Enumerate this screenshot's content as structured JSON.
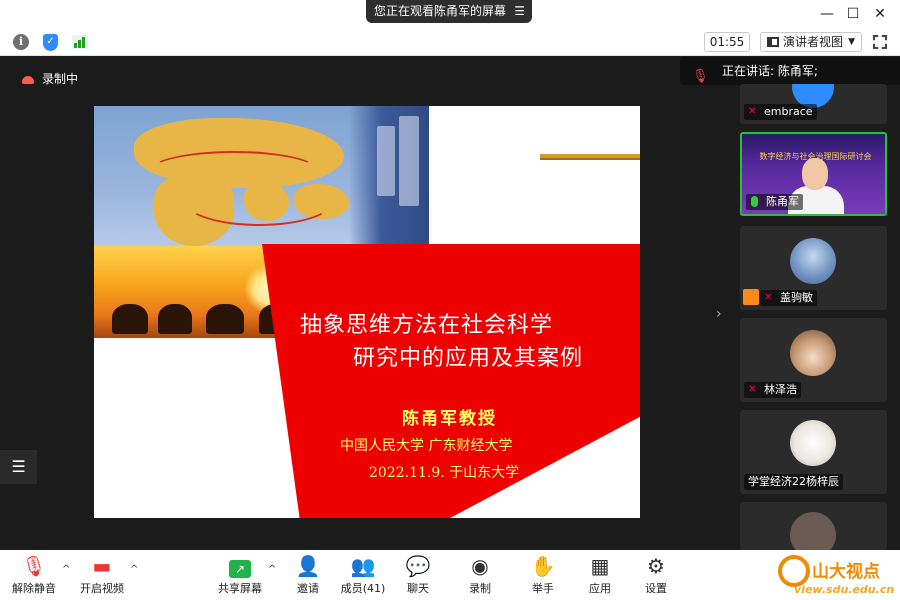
{
  "titlebar": {
    "share_status": "您正在观看陈甬军的屏幕",
    "minimize": "—",
    "maximize": "☐",
    "close": "✕"
  },
  "toolbar": {
    "timer": "01:55",
    "view_mode": "演讲者视图"
  },
  "recording": {
    "label": "录制中"
  },
  "speaker": {
    "label": "正在讲话: 陈甬军;"
  },
  "slide": {
    "title_line1": "抽象思维方法在社会科学",
    "title_line2": "研究中的应用及其案例",
    "author": "陈甬军教授",
    "affiliation": "中国人民大学  广东财经大学",
    "date": "2022.11.9. 于山东大学"
  },
  "participants": [
    {
      "name": "embrace"
    },
    {
      "name": "陈甬军",
      "banner": "数字经济与社会治理国际研讨会"
    },
    {
      "name": "盖驹敏"
    },
    {
      "name": "林泽浩"
    },
    {
      "name": "学堂经济22杨梓辰"
    }
  ],
  "bottom_toolbar": {
    "unmute": "解除静音",
    "start_video": "开启视频",
    "share_screen": "共享屏幕",
    "invite": "邀请",
    "participants": "成员(41)",
    "chat": "聊天",
    "record": "录制",
    "raise_hand": "举手",
    "apps": "应用",
    "settings": "设置"
  },
  "watermark": {
    "brand": "山大视点",
    "url": "view.sdu.edu.cn"
  },
  "colors": {
    "accent_blue": "#2d8cff",
    "active_green": "#26c236",
    "slide_red": "#e00000",
    "slide_yellow": "#ffff66",
    "record_red": "#ff5a4e"
  }
}
